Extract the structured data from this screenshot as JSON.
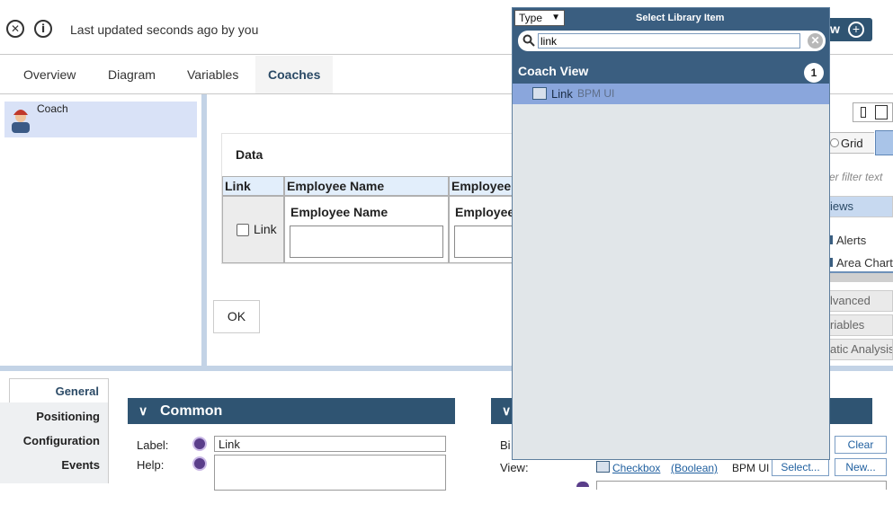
{
  "header": {
    "status_text": "Last updated seconds ago by you",
    "right_button_text": "w"
  },
  "tabs": [
    {
      "label": "Overview"
    },
    {
      "label": "Diagram"
    },
    {
      "label": "Variables"
    },
    {
      "label": "Coaches"
    }
  ],
  "coach_list": {
    "item_label": "Coach"
  },
  "canvas": {
    "section_title": "Data",
    "grid": {
      "headers": [
        "Link",
        "Employee Name",
        "Employee"
      ],
      "checkbox_label": "Link",
      "cell_labels": [
        "Employee Name",
        "Employee"
      ]
    },
    "ok_label": "OK"
  },
  "palette": {
    "grid_label": "Grid",
    "filter_placeholder": "er filter text",
    "views_label": "iews",
    "items": [
      "Alerts",
      "Area Chart"
    ],
    "sections": [
      "lvanced",
      "riables",
      "atic Analysis"
    ]
  },
  "properties": {
    "nav": [
      "General",
      "Positioning",
      "Configuration",
      "Events"
    ],
    "section_common": "Common",
    "label_label": "Label:",
    "label_value": "Link",
    "help_label": "Help:",
    "binding_label": "Bi",
    "view_label": "View:",
    "view_link": "Checkbox",
    "view_type": "(Boolean)",
    "view_lib": "BPM UI",
    "clear_label": "Clear",
    "select_label": "Select...",
    "new_label": "New..."
  },
  "library_popup": {
    "type_label": "Type",
    "title": "Select Library Item",
    "search_value": "link",
    "category": "Coach View",
    "count": "1",
    "result_name": "Link",
    "result_lib": "BPM UI"
  }
}
